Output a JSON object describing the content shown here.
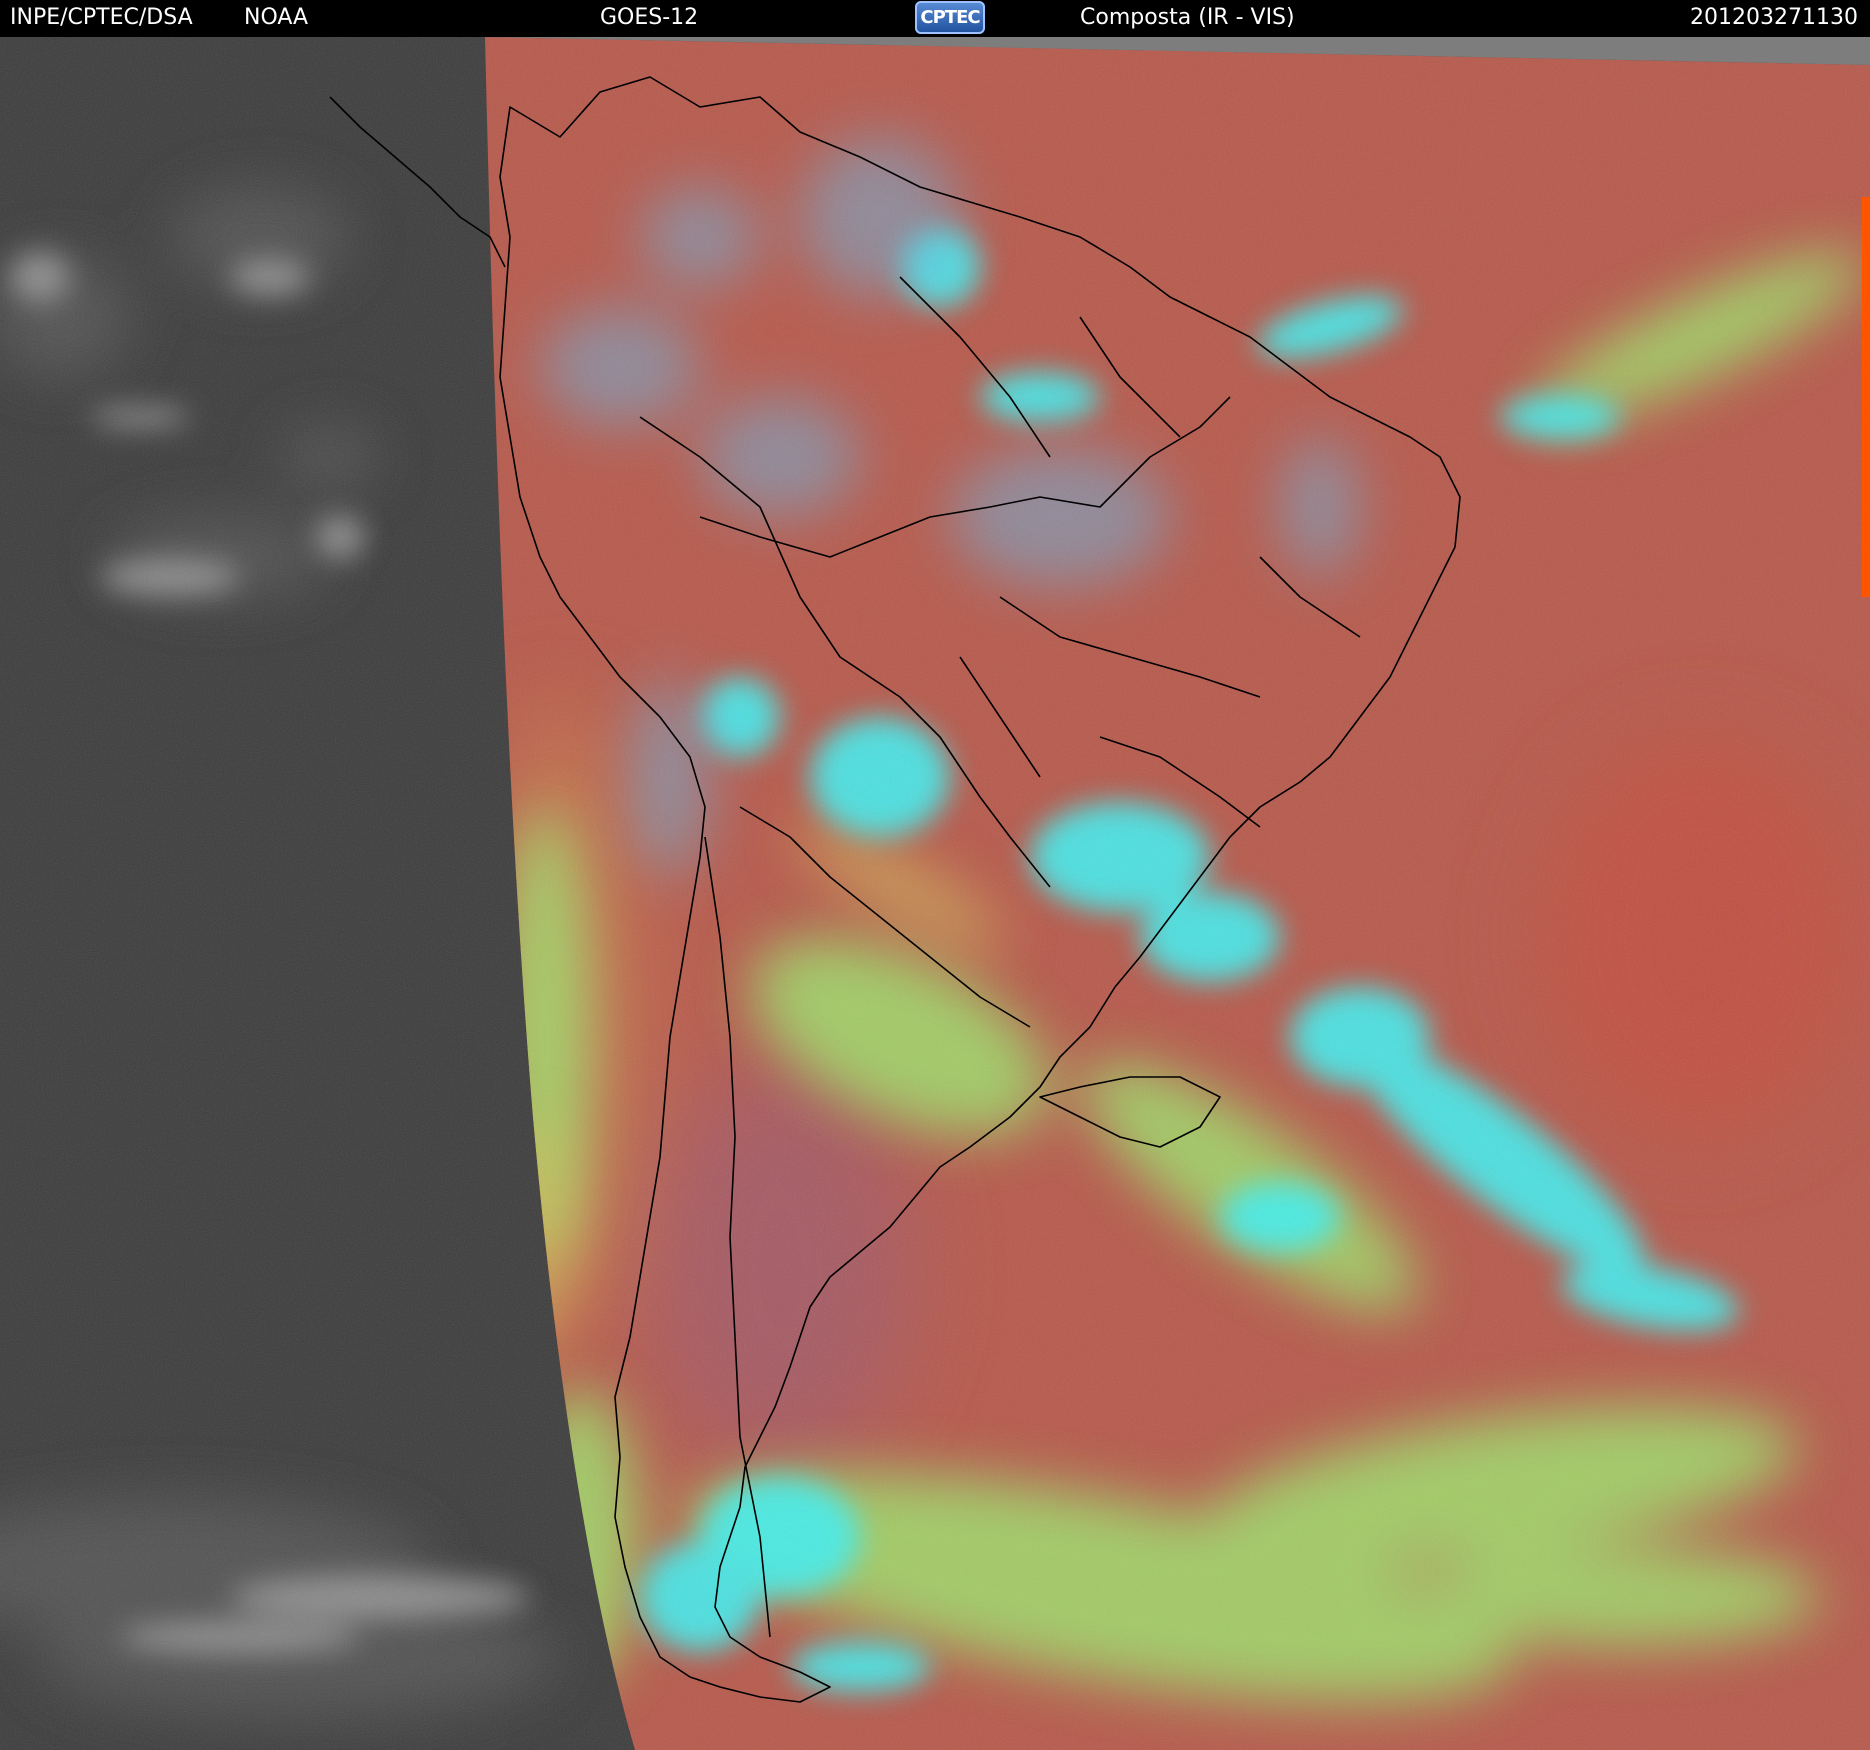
{
  "header": {
    "agency": "INPE/CPTEC/DSA",
    "partner": "NOAA",
    "satellite": "GOES-12",
    "logo_text": "CPTEC",
    "product": "Composta (IR - VIS)",
    "timestamp": "201203271130"
  },
  "colors": {
    "header_bg": "#000000",
    "header_text": "#ffffff",
    "clear_sky": "#b85a4a",
    "low_cloud": "#9fe06a",
    "high_cloud": "#38f2f2",
    "night_ir": "#3c3c3c",
    "boundaries": "#000000"
  }
}
